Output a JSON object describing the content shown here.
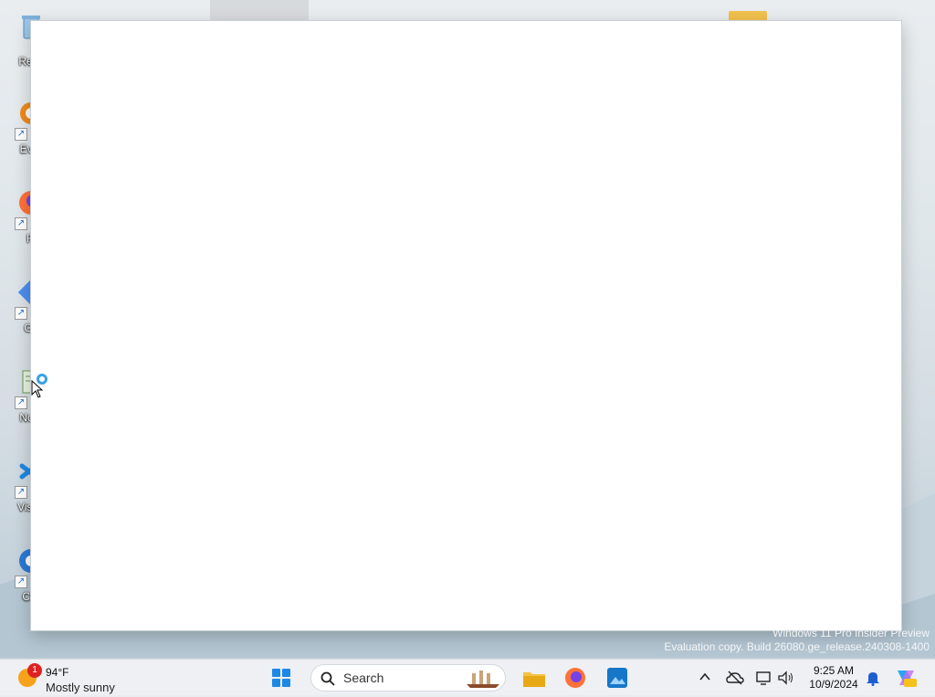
{
  "desktop": {
    "icons": [
      {
        "label": "Recy",
        "icon": "recycle-bin-icon"
      },
      {
        "label": "Ever",
        "icon": "everything-icon"
      },
      {
        "label": "Fi",
        "icon": "firefox-icon"
      },
      {
        "label": "Git",
        "icon": "git-icon"
      },
      {
        "label": "Note",
        "icon": "notepad-icon"
      },
      {
        "label": "Visua",
        "icon": "vscode-icon"
      },
      {
        "label": "Chr",
        "icon": "chrome-icon"
      }
    ],
    "watermark": {
      "line1": "Windows 11 Pro Insider Preview",
      "line2": "Evaluation copy. Build 26080.ge_release.240308-1400"
    }
  },
  "taskbar": {
    "weather": {
      "badge": "1",
      "temp": "94°F",
      "condition": "Mostly sunny"
    },
    "search_label": "Search",
    "pinned": [
      {
        "name": "start-button",
        "icon": "windows-start-icon"
      },
      {
        "name": "file-explorer-button",
        "icon": "folder-icon"
      },
      {
        "name": "firefox-button",
        "icon": "firefox-icon"
      },
      {
        "name": "photos-button",
        "icon": "photos-icon"
      }
    ],
    "tray": {
      "time": "9:25 AM",
      "date": "10/9/2024"
    }
  },
  "colors": {
    "accent": "#1e88e5",
    "window_bg": "#ffffff",
    "taskbar_bg": "#eef0f3"
  }
}
